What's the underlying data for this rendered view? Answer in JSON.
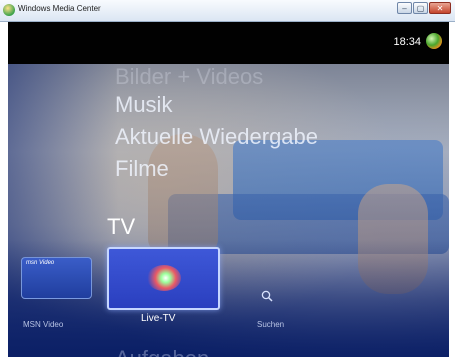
{
  "window": {
    "title": "Windows Media Center",
    "minimize_glyph": "–",
    "maximize_glyph": "▢",
    "close_glyph": "✕"
  },
  "status": {
    "clock": "18:34"
  },
  "menu": {
    "items": [
      "Bilder + Videos",
      "Musik",
      "Aktuelle Wiedergabe",
      "Filme"
    ],
    "section_title": "TV",
    "next_section": "Aufgaben"
  },
  "tiles": [
    {
      "label": "MSN Video",
      "logo_text": "msn Video"
    },
    {
      "label": "Live-TV"
    },
    {
      "label": "Suchen",
      "icon": "search-icon"
    }
  ],
  "colors": {
    "accent": "#2a3fbf",
    "background": "#0a1e58"
  }
}
